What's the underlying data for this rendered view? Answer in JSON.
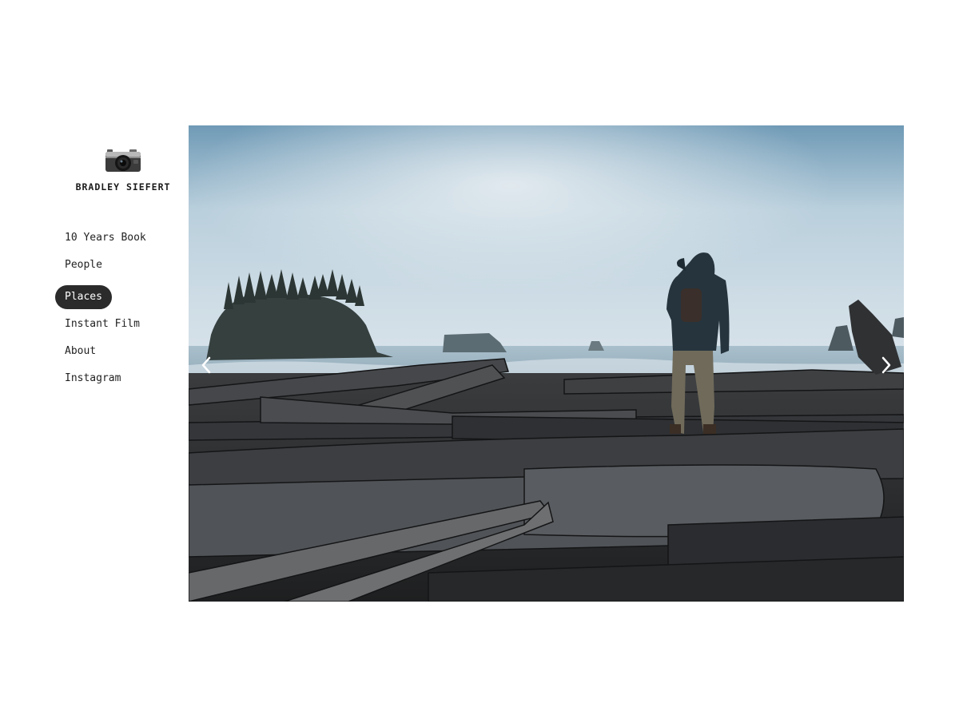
{
  "site": {
    "name": "BRADLEY SIEFERT",
    "logo_icon": "camera-icon"
  },
  "nav": {
    "items": [
      {
        "label": "10 Years Book",
        "active": false
      },
      {
        "label": "People",
        "active": false
      },
      {
        "label": "Places",
        "active": true
      },
      {
        "label": "Instant Film",
        "active": false
      },
      {
        "label": "About",
        "active": false
      },
      {
        "label": "Instagram",
        "active": false
      }
    ],
    "active_color": "#2b2b2b"
  },
  "slideshow": {
    "prev_icon": "chevron-left-icon",
    "next_icon": "chevron-right-icon",
    "image_subject": "hiker-on-driftwood-beach-photo"
  }
}
